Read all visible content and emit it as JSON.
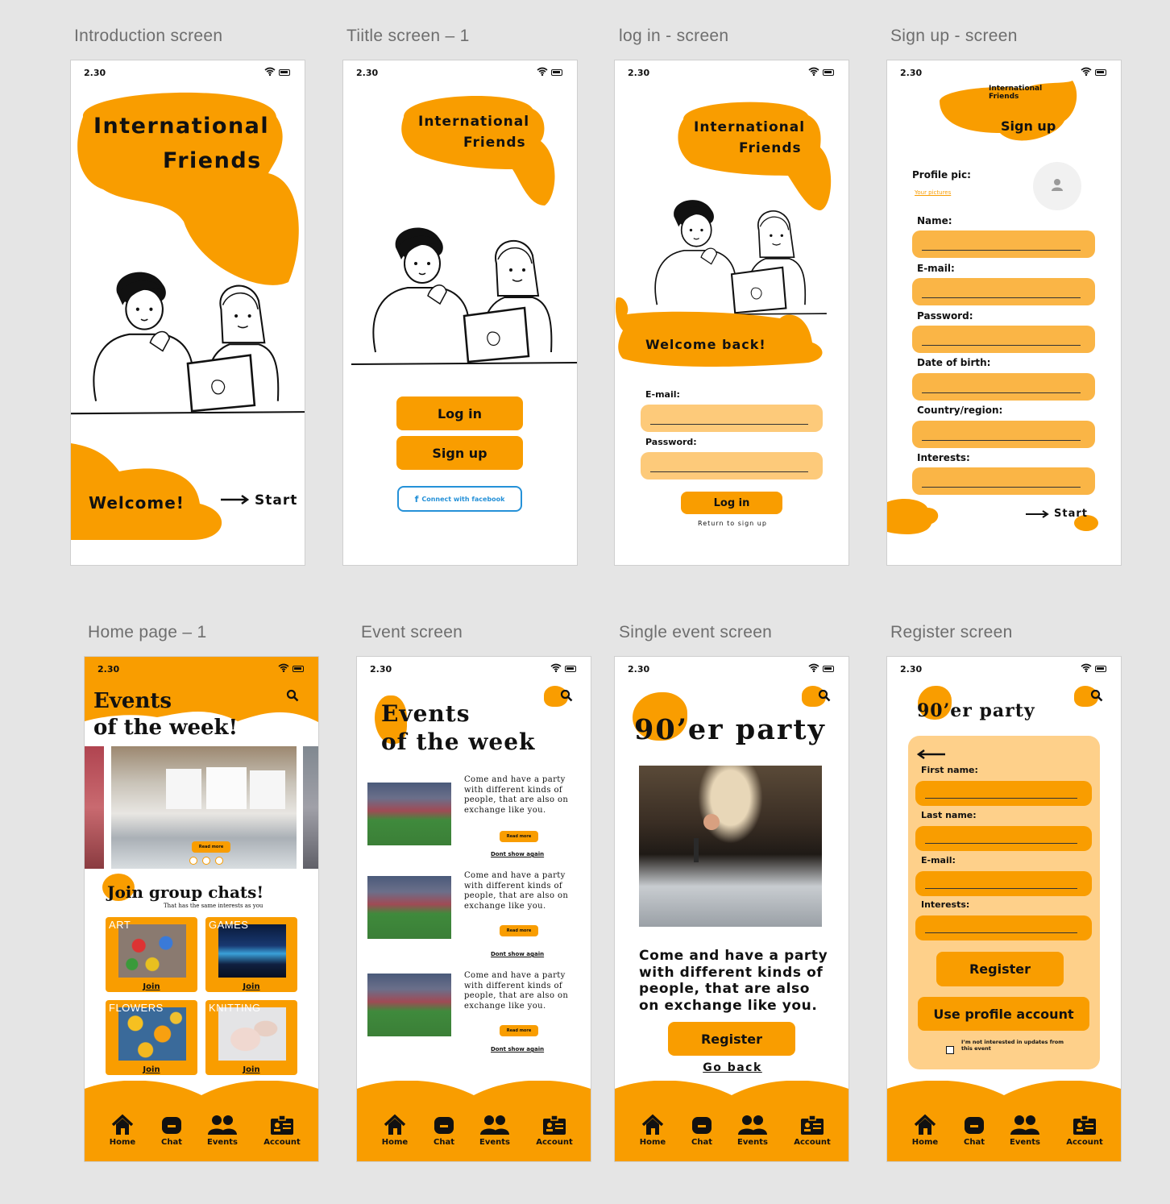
{
  "labels": {
    "intro": "Introduction screen",
    "title1": "Tiitle screen – 1",
    "login": "log in - screen",
    "signup": "Sign up - screen",
    "home": "Home page – 1",
    "event": "Event screen",
    "single": "Single event screen",
    "register": "Register screen"
  },
  "status": {
    "time": "2.30"
  },
  "app": {
    "name_line1": "International",
    "name_line2": "Friends"
  },
  "intro": {
    "welcome": "Welcome!",
    "start": "Start"
  },
  "title_screen": {
    "login": "Log in",
    "signup": "Sign up",
    "facebook": "Connect with facebook"
  },
  "login_screen": {
    "welcome_back": "Welcome back!",
    "email_label": "E-mail:",
    "password_label": "Password:",
    "login_button": "Log in",
    "return_link": "Return to sign up"
  },
  "signup_screen": {
    "header": "Sign up",
    "profile_pic": "Profile pic:",
    "your_pictures": "Your pictures",
    "fields": [
      "Name:",
      "E-mail:",
      "Password:",
      "Date of birth:",
      "Country/region:",
      "Interests:"
    ],
    "start": "Start"
  },
  "home": {
    "events_title1": "Events",
    "events_title2": "of the week!",
    "read_more": "Read more",
    "join_title": "Join group chats!",
    "join_sub": "That has the same interests as you",
    "tiles": [
      {
        "name": "ART",
        "join": "Join"
      },
      {
        "name": "GAMES",
        "join": "Join"
      },
      {
        "name": "FLOWERS",
        "join": "Join"
      },
      {
        "name": "KNITTING",
        "join": "Join"
      }
    ]
  },
  "events_screen": {
    "title1": "Events",
    "title2": "of the week",
    "items": [
      {
        "text": "Come and have a party with different kinds of people, that are also on exchange like you.",
        "read": "Read more",
        "dont": "Dont show again"
      },
      {
        "text": "Come and have a party with different kinds of people, that are also on exchange like you.",
        "read": "Read more",
        "dont": "Dont show again"
      },
      {
        "text": "Come and have a party with different kinds of people, that are also on exchange like you.",
        "read": "Read more",
        "dont": "Dont show again"
      }
    ]
  },
  "single_event": {
    "title": "90’er party",
    "description": "Come and have a party with different kinds of people, that are also on exchange like you.",
    "register": "Register",
    "go_back": "Go back"
  },
  "register_screen": {
    "title": "90’er party",
    "fields": [
      "First name:",
      "Last name:",
      "E-mail:",
      "Interests:"
    ],
    "register": "Register",
    "use_profile": "Use profile account",
    "optout": "I’m not interested in updates from this event"
  },
  "nav": {
    "home": "Home",
    "chat": "Chat",
    "events": "Events",
    "account": "Account"
  },
  "colors": {
    "accent": "#f99d00",
    "field": "#fab546",
    "field_light": "#fdca7a",
    "panel": "#fed08a"
  }
}
